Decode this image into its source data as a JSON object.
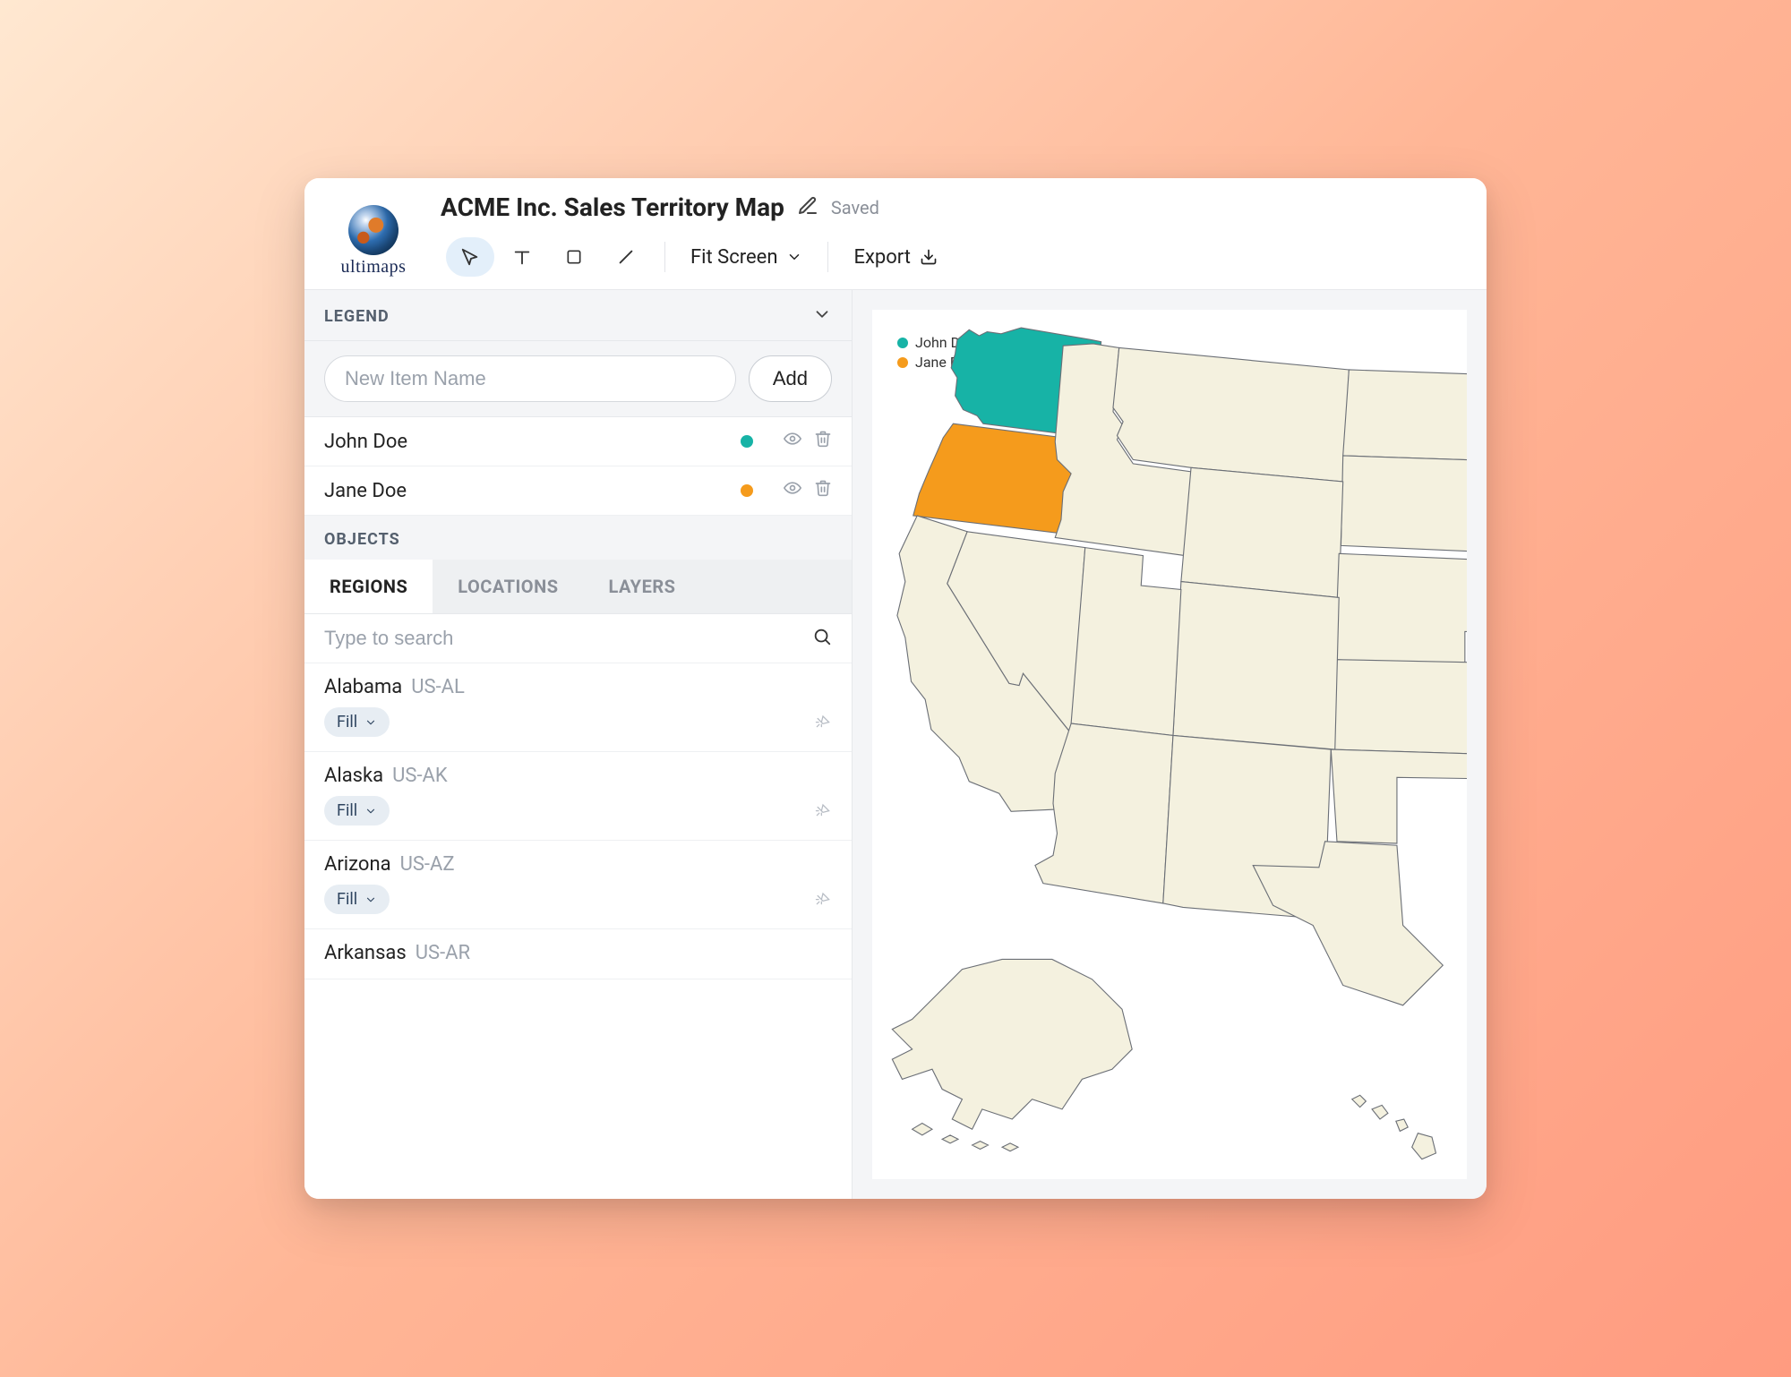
{
  "brand": {
    "name": "ultimaps"
  },
  "header": {
    "title": "ACME Inc. Sales Territory Map",
    "status": "Saved"
  },
  "toolbar": {
    "fit_label": "Fit Screen",
    "export_label": "Export"
  },
  "legend": {
    "heading": "LEGEND",
    "input_placeholder": "New Item Name",
    "add_label": "Add",
    "items": [
      {
        "name": "John Doe",
        "color": "#17b3a6"
      },
      {
        "name": "Jane Doe",
        "color": "#f59b1c"
      }
    ]
  },
  "objects": {
    "heading": "OBJECTS",
    "tabs": [
      {
        "label": "REGIONS",
        "active": true
      },
      {
        "label": "LOCATIONS",
        "active": false
      },
      {
        "label": "LAYERS",
        "active": false
      }
    ],
    "search_placeholder": "Type to search",
    "fill_label": "Fill",
    "regions": [
      {
        "name": "Alabama",
        "code": "US-AL"
      },
      {
        "name": "Alaska",
        "code": "US-AK"
      },
      {
        "name": "Arizona",
        "code": "US-AZ"
      },
      {
        "name": "Arkansas",
        "code": "US-AR"
      }
    ]
  },
  "map_legend": {
    "items": [
      {
        "label": "John Doe",
        "color": "#17b3a6"
      },
      {
        "label": "Jane Doe",
        "color": "#f59b1c"
      }
    ]
  },
  "colors": {
    "accent_teal": "#17b3a6",
    "accent_orange": "#f59b1c",
    "land": "#f4f1df",
    "border": "#6b6f76"
  }
}
